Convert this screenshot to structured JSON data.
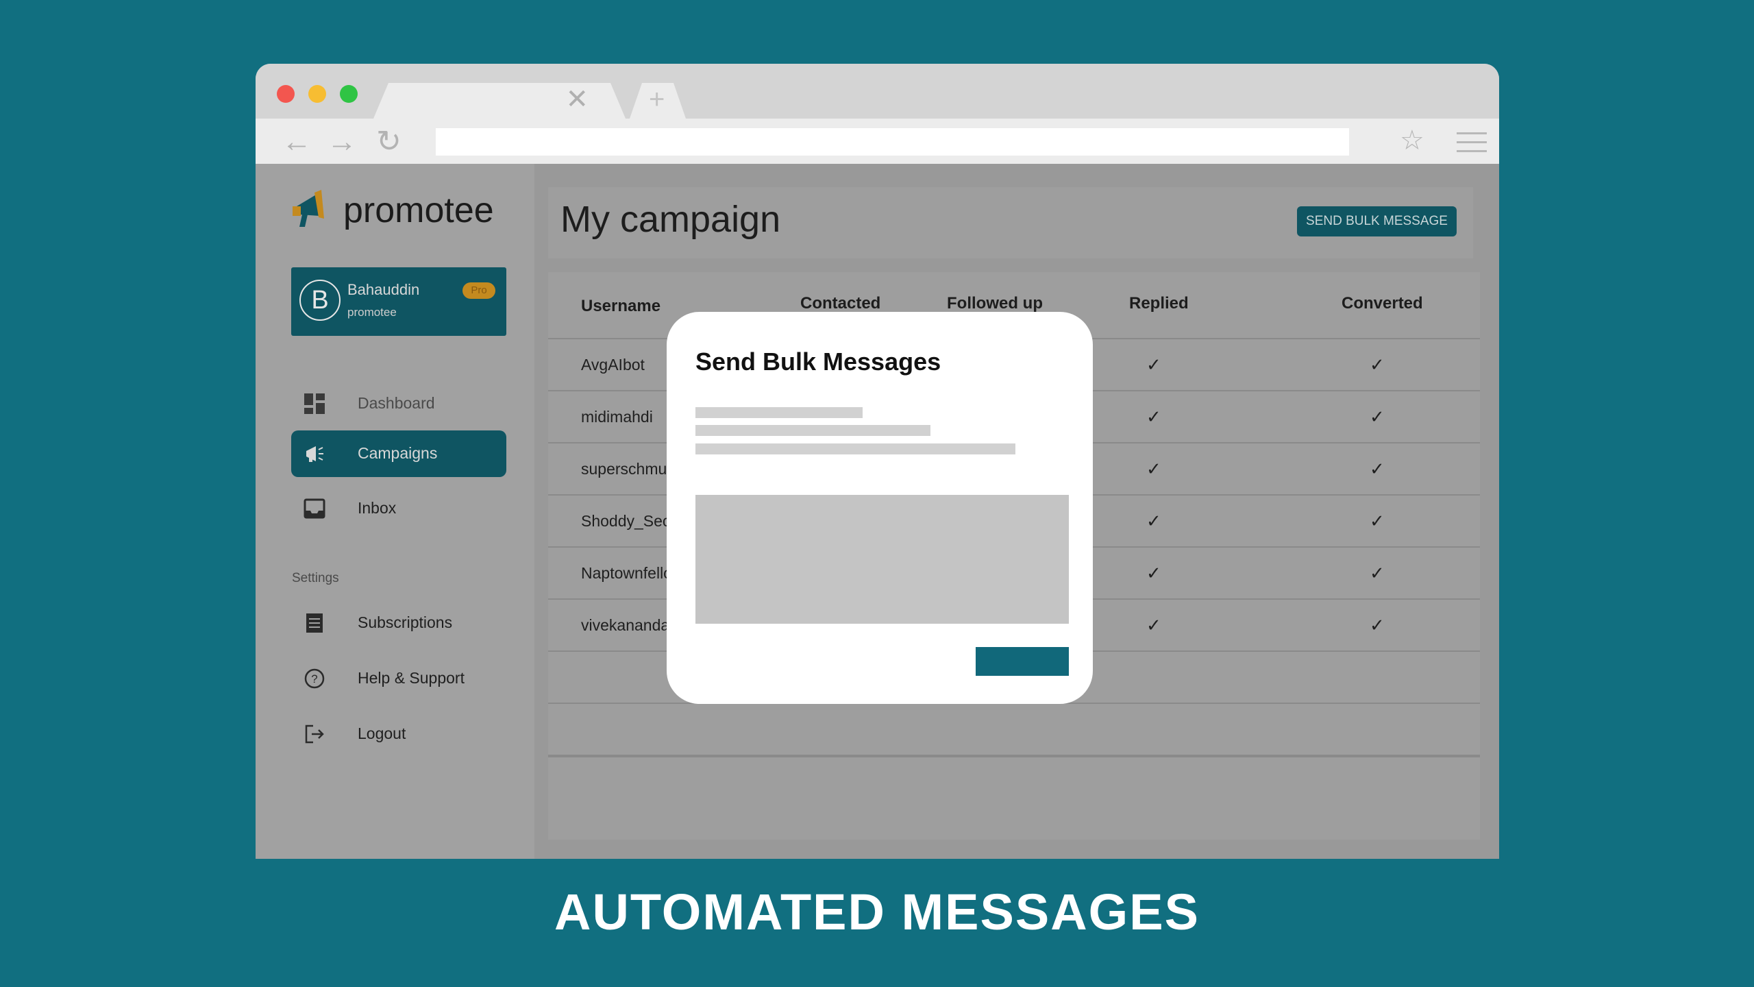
{
  "browser": {
    "tab_close_glyph": "✕",
    "new_tab_glyph": "+",
    "back_glyph": "←",
    "forward_glyph": "→",
    "reload_glyph": "↻",
    "star_glyph": "☆"
  },
  "app": {
    "logo_text": "promotee",
    "user": {
      "initial": "B",
      "name": "Bahauddin",
      "badge": "Pro",
      "org": "promotee"
    },
    "nav": [
      {
        "label": "Dashboard",
        "icon": "dashboard-icon"
      },
      {
        "label": "Campaigns",
        "icon": "megaphone-icon"
      },
      {
        "label": "Inbox",
        "icon": "inbox-icon"
      }
    ],
    "settings_label": "Settings",
    "settings_nav": [
      {
        "label": "Subscriptions",
        "icon": "receipt-icon"
      },
      {
        "label": "Help & Support",
        "icon": "help-icon"
      },
      {
        "label": "Logout",
        "icon": "logout-icon"
      }
    ]
  },
  "main": {
    "title": "My campaign",
    "bulk_button": "SEND BULK MESSAGE",
    "columns": [
      "Username",
      "Contacted",
      "Followed up",
      "Replied",
      "Converted"
    ],
    "check_glyph": "✓",
    "rows": [
      {
        "username": "AvgAIbot"
      },
      {
        "username": "midimahdi"
      },
      {
        "username": "superschmur"
      },
      {
        "username": "Shoddy_Sect"
      },
      {
        "username": "Naptownfello"
      },
      {
        "username": "vivekananda"
      }
    ]
  },
  "modal": {
    "title": "Send Bulk Messages"
  },
  "caption": "AUTOMATED MESSAGES",
  "colors": {
    "background": "#116f80",
    "brand": "#0f5562",
    "modal_button": "#11687a"
  }
}
